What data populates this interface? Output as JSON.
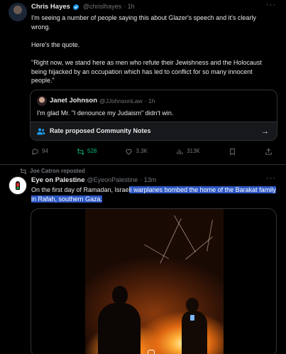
{
  "colors": {
    "background": "#000000",
    "text": "#e7e9ea",
    "muted": "#71767b",
    "accent": "#1d9bf0",
    "repost_green": "#00ba7c",
    "highlight": "#2c57c4",
    "border": "#2f3336"
  },
  "tweet1": {
    "author_name": "Chris Hayes",
    "handle": "@chrislhayes",
    "time": "· 1h",
    "verified_icon": "verified-badge-icon",
    "more_label": "···",
    "text_p1": "I'm seeing a number of people saying this about Glazer's speech and it's clearly wrong.",
    "text_p2": "Here's the quote.",
    "text_p3": "\"Right now, we stand here as men who refute their Jewishness and the Holocaust being hijacked by an occupation which has led to conflict for so many innocent people.\"",
    "quote": {
      "author_name": "Janet Johnson",
      "handle": "@JJohnsonLaw",
      "time": "· 1h",
      "text": "I'm glad Mr. \"I denounce my Judaism\" didn't win.",
      "community_notes_label": "Rate proposed Community Notes",
      "arrow": "→"
    },
    "actions": {
      "replies": "94",
      "reposts": "528",
      "likes": "3.3K",
      "views": "313K"
    }
  },
  "tweet2": {
    "reposted_by": "Joe Catron reposted",
    "author_name": "Eye on Palestine",
    "handle": "@EyeonPalestine",
    "time": "· 13m",
    "more_label": "···",
    "text_plain": "On the first day of Ramadan, Israe",
    "text_highlighted": "li warplanes bombed the home of the Barakat family in Rafah, southern Gaza."
  }
}
